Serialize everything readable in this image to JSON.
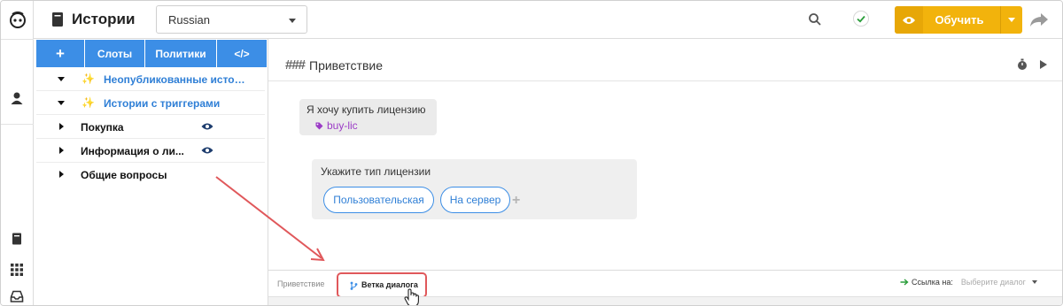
{
  "header": {
    "title": "Истории",
    "language": "Russian",
    "train_label": "Обучить"
  },
  "sidebar": {
    "tabs": [
      {
        "label": "+"
      },
      {
        "label": "Слоты"
      },
      {
        "label": "Политики"
      },
      {
        "label": "</>"
      }
    ],
    "tree": [
      {
        "label": "Неопубликованные истор...",
        "highlight": true,
        "expanded": true
      },
      {
        "label": "Истории с триггерами",
        "highlight": true,
        "expanded": true
      },
      {
        "label": "Покупка",
        "highlight": false,
        "expanded": false,
        "eye": true
      },
      {
        "label": "Информация о ли...",
        "highlight": false,
        "expanded": false,
        "eye": true
      },
      {
        "label": "Общие вопросы",
        "highlight": false,
        "expanded": false,
        "eye": false
      }
    ]
  },
  "story": {
    "name": "Приветствие",
    "user_message": "Я хочу купить лицензию",
    "intent": "buy-lic",
    "bot_message": "Укажите тип лицензии",
    "buttons": [
      "Пользовательская",
      "На сервер"
    ]
  },
  "footer": {
    "breadcrumb": "Приветствие",
    "branch_label": "Ветка диалога",
    "link_label": "Ссылка на:",
    "link_placeholder": "Выберите диалог"
  },
  "colors": {
    "accent": "#3c8ee6",
    "train": "#f2b30c",
    "intent": "#9b3cc6",
    "highlight_box": "#e0585b"
  }
}
